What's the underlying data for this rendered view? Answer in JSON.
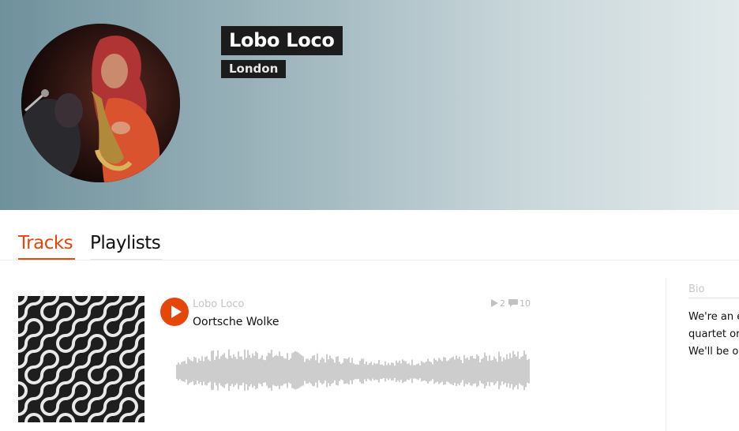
{
  "artist": {
    "name": "Lobo Loco",
    "city": "London"
  },
  "tabs": [
    {
      "label": "Tracks",
      "active": true
    },
    {
      "label": "Playlists",
      "active": false
    }
  ],
  "track": {
    "artist": "Lobo Loco",
    "title": "Oortsche Wolke",
    "plays": "2",
    "comments": "10"
  },
  "sidebar": {
    "bio_label": "Bio",
    "bio_lines": [
      "We're an e",
      "quartet or",
      "We'll be or"
    ]
  },
  "colors": {
    "accent": "#e5460a",
    "name_badge_bg": "#1c1c1c",
    "waveform": "#9b9b9b"
  },
  "icons": {
    "play": "play-icon",
    "plays_stat": "play-count-icon",
    "comments_stat": "comment-icon"
  }
}
